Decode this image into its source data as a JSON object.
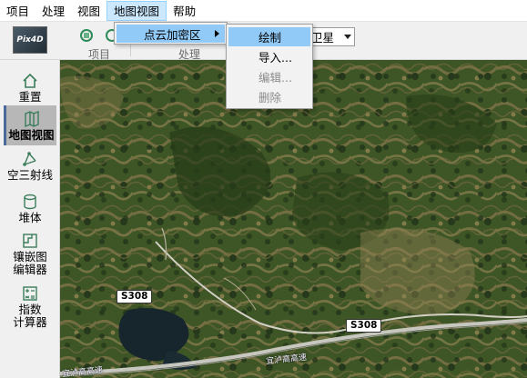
{
  "menubar": {
    "items": [
      {
        "label": "项目"
      },
      {
        "label": "处理"
      },
      {
        "label": "视图"
      },
      {
        "label": "地图视图",
        "active": true
      },
      {
        "label": "帮助"
      }
    ]
  },
  "ribbon": {
    "logo_text": "Pix4D",
    "groups": [
      {
        "label": "项目"
      },
      {
        "label": "处理"
      }
    ],
    "basemap_select": {
      "value": "卫星"
    }
  },
  "leftnav": {
    "items": [
      {
        "label": "重置",
        "icon": "house-icon"
      },
      {
        "label": "地图视图",
        "icon": "map-icon",
        "active": true
      },
      {
        "label": "空三射线",
        "icon": "ray-icon"
      },
      {
        "label": "堆体",
        "icon": "volume-icon"
      },
      {
        "label": "镶嵌图\n编辑器",
        "label_line1": "镶嵌图",
        "label_line2": "编辑器",
        "icon": "mosaic-icon"
      },
      {
        "label_line1": "指数",
        "label_line2": "计算器",
        "icon": "calculator-icon"
      }
    ]
  },
  "map": {
    "road_labels": [
      "S308",
      "S308"
    ],
    "highway_labels": [
      "宜泸高高速",
      "宜泸高高速"
    ]
  },
  "dropdown_map_view": {
    "items": [
      {
        "label": "点云加密区",
        "has_submenu": true
      }
    ]
  },
  "dropdown_submenu": {
    "items": [
      {
        "label": "绘制",
        "state": "highlighted"
      },
      {
        "label": "导入...",
        "state": "enabled"
      },
      {
        "label": "编辑...",
        "state": "disabled"
      },
      {
        "label": "删除",
        "state": "disabled"
      }
    ]
  },
  "colors": {
    "menu_active_bg": "#cce8ff",
    "menu_highlight": "#91c9f7",
    "nav_active_bg": "#b7b7b7",
    "map_dark_green": "#2f4a1e",
    "map_tan": "#8a7a4e"
  }
}
